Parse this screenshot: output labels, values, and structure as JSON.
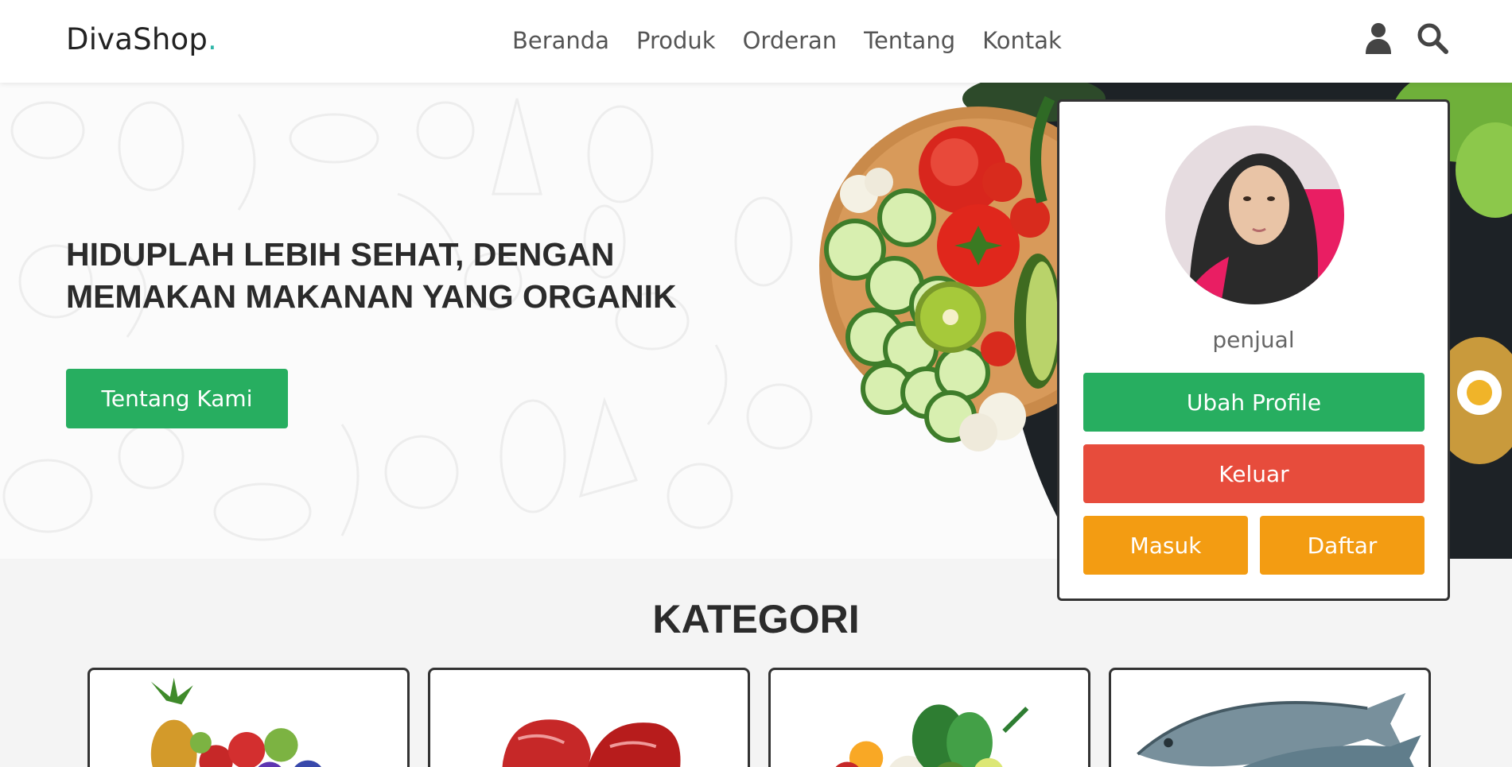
{
  "navbar": {
    "logo_text": "DivaShop",
    "logo_dot": ".",
    "links": [
      "Beranda",
      "Produk",
      "Orderan",
      "Tentang",
      "Kontak"
    ],
    "icons": [
      "user-icon",
      "search-icon"
    ]
  },
  "hero": {
    "title": "HIDUPLAH LEBIH SEHAT, DENGAN MEMAKAN MAKANAN YANG ORGANIK",
    "button_label": "Tentang Kami"
  },
  "profile": {
    "username": "penjual",
    "edit_label": "Ubah Profile",
    "logout_label": "Keluar",
    "login_label": "Masuk",
    "register_label": "Daftar"
  },
  "kategori": {
    "title": "KATEGORI",
    "cards": [
      "fruits",
      "meat",
      "vegetables",
      "fish"
    ]
  },
  "colors": {
    "accent_green": "#27ae60",
    "danger_red": "#e74c3c",
    "warning_orange": "#f39c12",
    "logo_dot": "#2fb6a8"
  }
}
